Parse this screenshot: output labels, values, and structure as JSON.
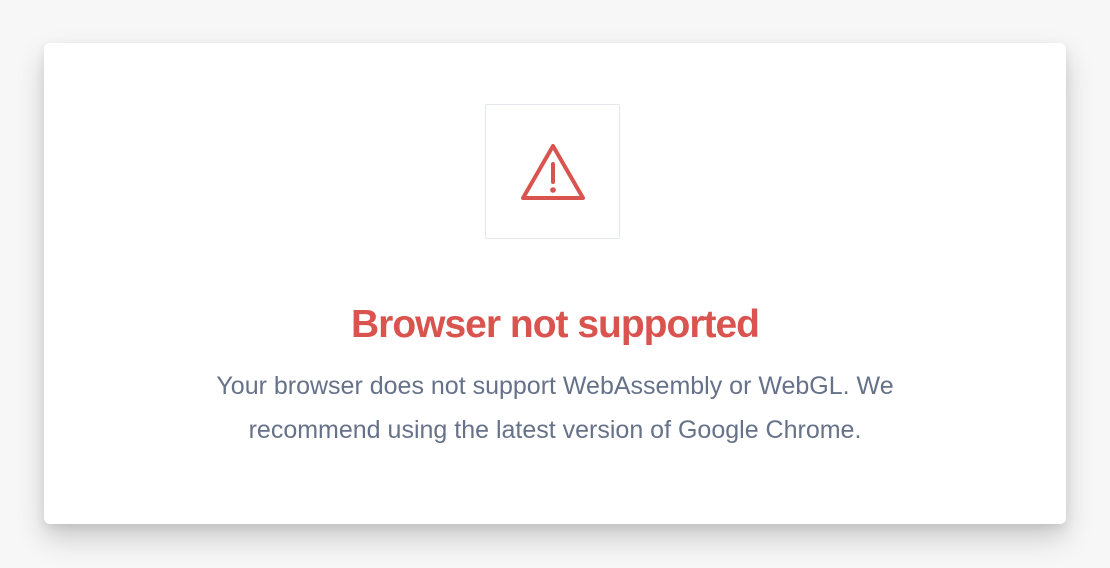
{
  "dialog": {
    "icon": "warning-triangle-icon",
    "title": "Browser not supported",
    "message_line1": "Your browser does not support WebAssembly or WebGL. We",
    "message_line2": "recommend using the latest version of Google Chrome."
  },
  "colors": {
    "accent": "#d9534f",
    "text": "#66718a",
    "background": "#f7f7f7",
    "card": "#ffffff",
    "icon_border": "#e3e6ec"
  }
}
